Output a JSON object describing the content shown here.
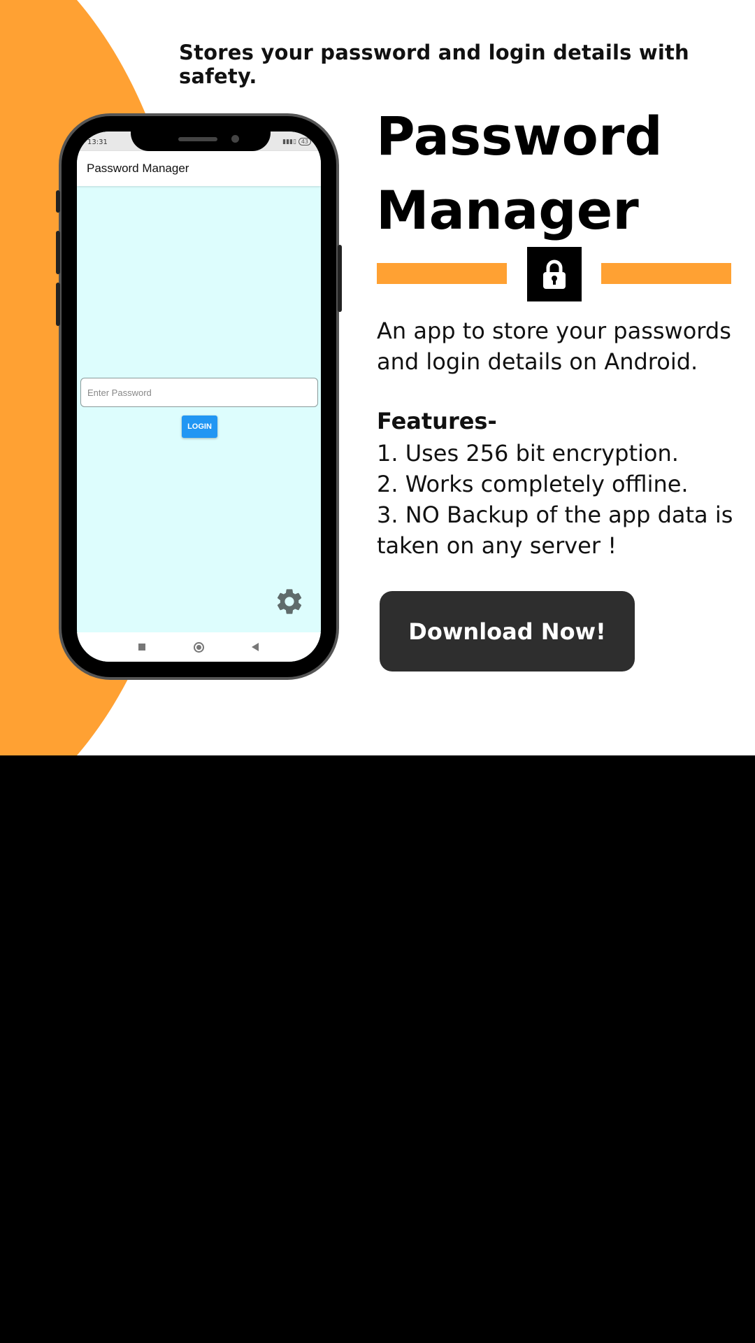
{
  "tagline": "Stores your password and login details with safety.",
  "title": "Password Manager",
  "description": "An app to store your passwords and login details on Android.",
  "features": {
    "heading": "Features-",
    "items": [
      "1. Uses 256 bit encryption.",
      "2. Works completely offline.",
      "3. NO Backup of the app data is taken on any server !"
    ]
  },
  "cta": {
    "label": "Download Now!"
  },
  "phone_screen": {
    "status_time": "13:31",
    "status_battery": "43",
    "app_title": "Password Manager",
    "password_placeholder": "Enter Password",
    "login_label": "LOGIN"
  },
  "colors": {
    "accent_orange": "#ffa133",
    "screen_bg": "#ddfdfd",
    "login_blue": "#2196f3",
    "cta_dark": "#2e2e2e"
  },
  "icons": [
    "lock-icon",
    "gear-icon",
    "nav-recents-icon",
    "nav-home-icon",
    "nav-back-icon",
    "signal-icon",
    "battery-icon"
  ]
}
